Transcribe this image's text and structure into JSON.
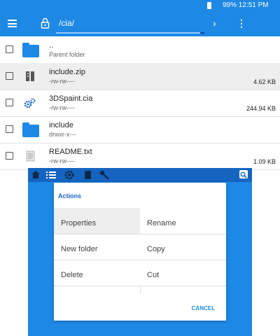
{
  "status": {
    "text": "99% 12:51 PM"
  },
  "toolbar": {
    "path": "/cia/",
    "forward_icon": "›",
    "more_icon": "⋮"
  },
  "files": [
    {
      "name": "..",
      "meta": "Parent folder",
      "size": "",
      "icon": "folder-icon"
    },
    {
      "name": "include.zip",
      "meta": "-rw-rw----",
      "size": "4.62 KB",
      "icon": "zip-icon"
    },
    {
      "name": "3DSpaint.cia",
      "meta": "-rw-rw----",
      "size": "244.94 KB",
      "icon": "gears-icon"
    },
    {
      "name": "include",
      "meta": "drwxr-x---",
      "size": "",
      "icon": "folder-icon"
    },
    {
      "name": "README.txt",
      "meta": "-rw-rw----",
      "size": "1.09 KB",
      "icon": "text-file-icon"
    }
  ],
  "dialog": {
    "title": "Actions",
    "actions": [
      "Properties",
      "Rename",
      "New folder",
      "Copy",
      "Delete",
      "Cut"
    ],
    "cancel": "CANCEL"
  },
  "colors": {
    "accent": "#1e88e5",
    "dark_accent": "#1565c0"
  }
}
